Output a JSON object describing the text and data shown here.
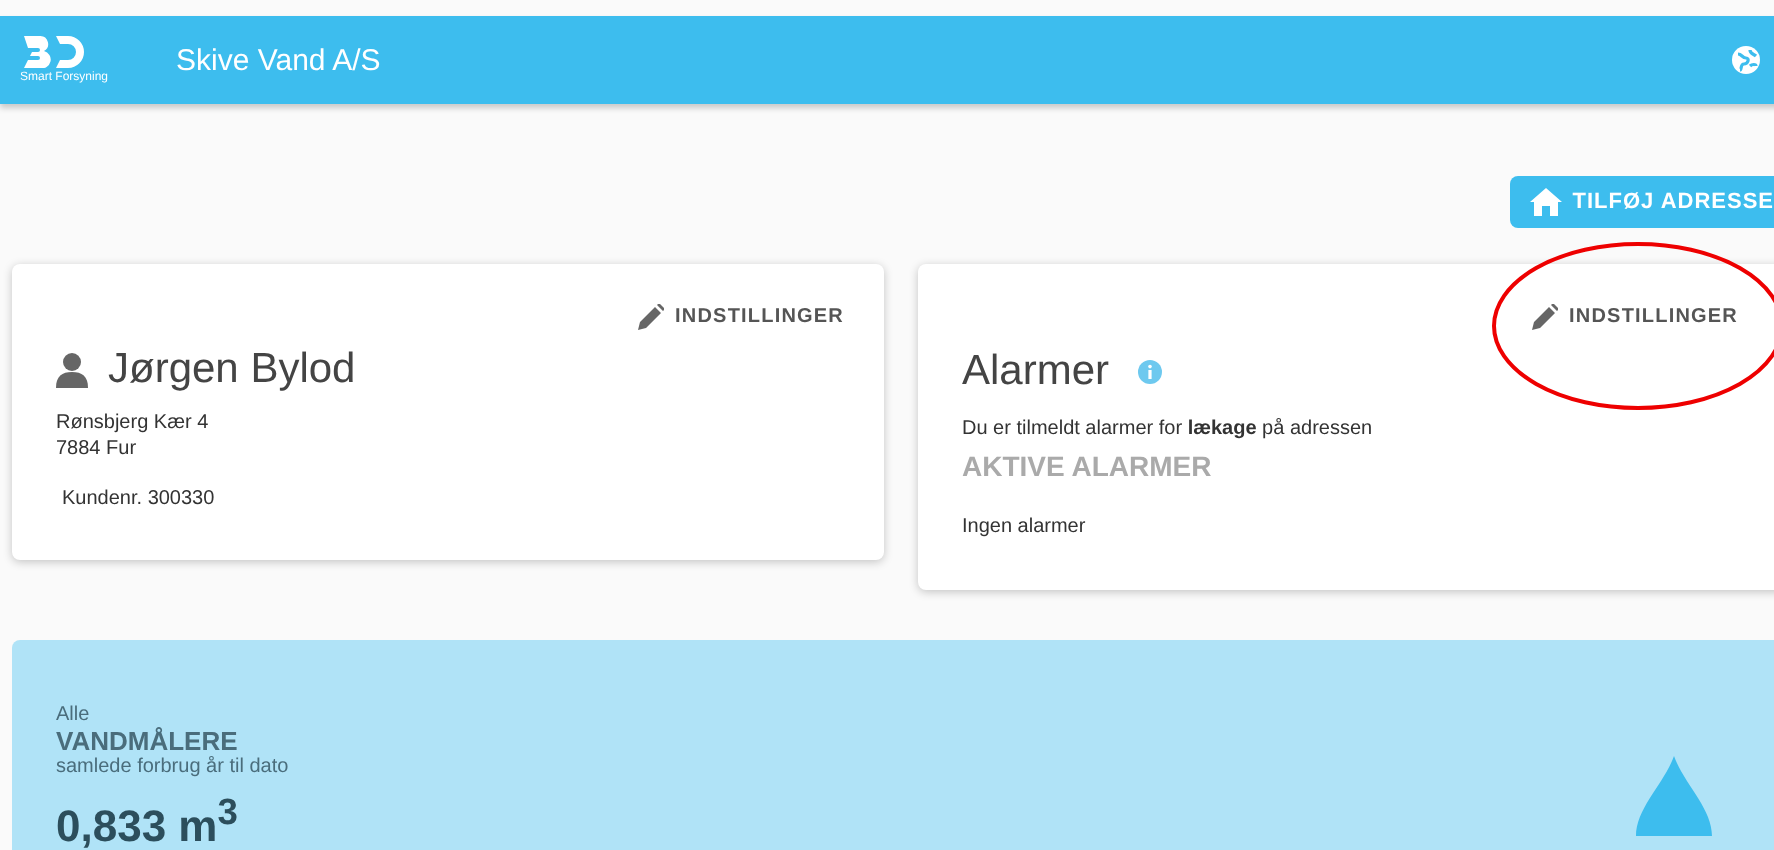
{
  "header": {
    "logo_text": "Smart Forsyning",
    "title": "Skive Vand A/S"
  },
  "add_address_button": "TILFØJ ADRESSE",
  "customer_card": {
    "settings_button": "INDSTILLINGER",
    "name": "Jørgen Bylod",
    "address_lines": [
      "Rønsbjerg Kær 4",
      "7884 Fur"
    ],
    "customer_number": "Kundenr. 300330"
  },
  "alarm_card": {
    "settings_button": "INDSTILLINGER",
    "title": "Alarmer",
    "description": "Du er tilmeldt alarmer for **lækage** på adressen",
    "active_heading": "AKTIVE ALARMER",
    "empty_text": "Ingen alarmer"
  },
  "consumption_panel": {
    "prefix": "Alle",
    "heading": "VANDMÅLERE",
    "subtitle": "samlede forbrug år til dato",
    "value": "0,833 m$^{3}$"
  }
}
